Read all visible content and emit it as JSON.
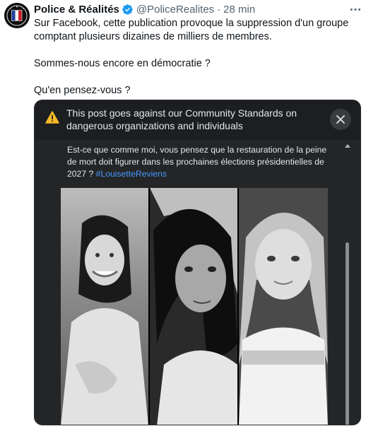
{
  "author": {
    "name": "Police & Réalités",
    "handle": "@PoliceRealites",
    "separator": "·",
    "time": "28 min"
  },
  "tweet": {
    "line1": "Sur Facebook, cette publication provoque la suppression d'un groupe comptant plusieurs dizaines de milliers de membres.",
    "line2": "Sommes-nous encore en démocratie ?",
    "line3": "Qu'en pensez-vous ?"
  },
  "embed": {
    "warning": "This post goes against our Community Standards on dangerous organizations and individuals",
    "post_text": "Est-ce que comme moi, vous pensez que la restauration de la peine de mort doit figurer dans les prochaines élections présidentielles de 2027 ?",
    "hashtag": "#LouisetteReviens"
  },
  "icons": {
    "more": "more-horizontal-icon",
    "verified": "verified-badge-icon",
    "warning": "warning-triangle-icon",
    "close": "close-icon"
  },
  "colors": {
    "verified": "#1d9bf0",
    "warning": "#f7b928",
    "hashtag": "#4599ff",
    "embed_bg": "#242526"
  }
}
